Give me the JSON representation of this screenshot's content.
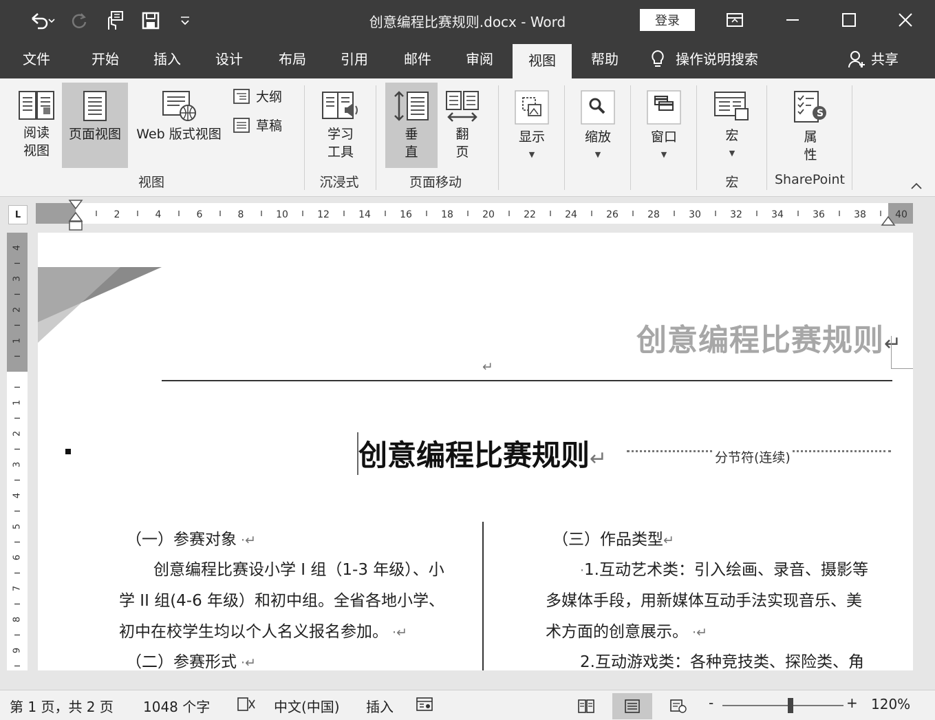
{
  "window": {
    "title": "创意编程比赛规则.docx  -  Word",
    "login_label": "登录"
  },
  "menu": {
    "items": [
      "文件",
      "开始",
      "插入",
      "设计",
      "布局",
      "引用",
      "邮件",
      "审阅",
      "视图",
      "帮助"
    ],
    "active": "视图",
    "tell_me": "操作说明搜索",
    "share": "共享"
  },
  "ribbon": {
    "read_mode": [
      "阅读",
      "视图"
    ],
    "print_layout": "页面视图",
    "web_layout": "Web 版式视图",
    "outline": "大纲",
    "draft": "草稿",
    "group_views": "视图",
    "learning_tools": [
      "学习",
      "工具"
    ],
    "group_immersive": "沉浸式",
    "vertical": [
      "垂",
      "直"
    ],
    "side_to_side": [
      "翻",
      "页"
    ],
    "group_page_movement": "页面移动",
    "show": "显示",
    "zoom": "缩放",
    "window": "窗口",
    "macros": "宏",
    "group_macros": "宏",
    "properties": [
      "属",
      "性"
    ],
    "group_sharepoint": "SharePoint"
  },
  "ruler": {
    "h_labels": [
      "2",
      "4",
      "6",
      "8",
      "10",
      "12",
      "14",
      "16",
      "18",
      "20",
      "22",
      "24",
      "26",
      "28",
      "30",
      "32",
      "34",
      "36",
      "38",
      "40"
    ],
    "v_top_labels": [
      "4",
      "3",
      "2",
      "1"
    ],
    "v_body_labels": [
      "1",
      "2",
      "3",
      "4",
      "5",
      "6",
      "7",
      "8",
      "9"
    ]
  },
  "document": {
    "header_text": "创意编程比赛规则",
    "header_mark": "↵",
    "empty_para_mark": "↵",
    "title": "创意编程比赛规则",
    "title_mark": "↵",
    "section_break": "分节符(连续)",
    "left_col": {
      "h1": "（一）参赛对象",
      "p1_l1": "创意编程比赛设小学 I 组（1-3 年级）、小",
      "p1_l2": "学 II 组(4-6 年级）和初中组。全省各地小学、",
      "p1_l3": "初中在校学生均以个人名义报名参加。",
      "h2": "（二）参赛形式"
    },
    "right_col": {
      "h3": "（三）作品类型",
      "p1_l1": "1.互动艺术类：引入绘画、录音、摄影等",
      "p1_l2": "多媒体手段，用新媒体互动手法实现音乐、美",
      "p1_l3": "术方面的创意展示。",
      "p2_l1": "2.互动游戏类：各种竞技类、探险类、角"
    }
  },
  "status": {
    "page": "第 1 页，共 2 页",
    "words": "1048 个字",
    "language": "中文(中国)",
    "mode": "插入",
    "zoom_minus": "-",
    "zoom_plus": "+",
    "zoom": "120%",
    "zoom_fraction": 0.56
  },
  "colors": {
    "titlebar": "#3c3c3c",
    "ribbon": "#f3f3f3",
    "pressed": "#c8c8c8",
    "header_gray": "#a7a7a7"
  }
}
